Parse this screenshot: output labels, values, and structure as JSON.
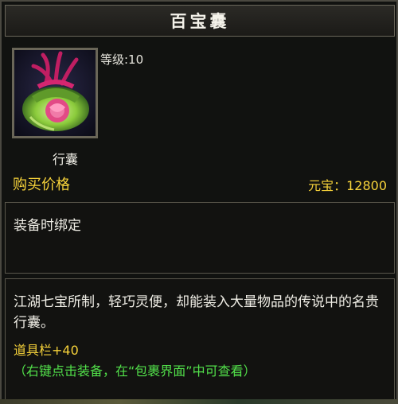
{
  "tooltip": {
    "title": "百宝囊",
    "item_icon": "pouch-icon",
    "level_label": "等级:10",
    "item_name": "行囊",
    "price_label": "购买价格",
    "price_value": "元宝：12800",
    "bind_status": "装备时绑定",
    "description": "江湖七宝所制，轻巧灵便，却能装入大量物品的传说中的名贵行囊。",
    "stat": "道具栏+40",
    "hint": "（右键点击装备，在“包裹界面”中可查看）"
  },
  "colors": {
    "gold": "#f6d23a",
    "green": "#52e04a",
    "text": "#f0eee6",
    "background": "#111210",
    "border": "#5a574c"
  }
}
